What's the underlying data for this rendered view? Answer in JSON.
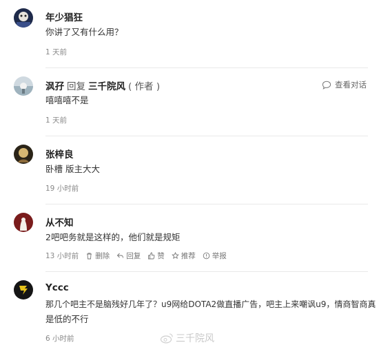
{
  "comments": [
    {
      "username": "年少猖狂",
      "text": "你讲了又有什么用？",
      "time": "1 天前"
    },
    {
      "username": "沨孖",
      "reply_word": "回复",
      "reply_target": "三千院风",
      "author_tag": "( 作者 )",
      "view_conversation": "查看对话",
      "text": "嘻嘻嘻不是",
      "time": "1 天前"
    },
    {
      "username": "张梓良",
      "text": "卧槽 版主大大",
      "time": "19 小时前"
    },
    {
      "username": "从不知",
      "text": "2吧吧务就是这样的，他们就是规矩",
      "time": "13 小时前",
      "actions": {
        "delete": "删除",
        "reply": "回复",
        "like": "赞",
        "recommend": "推荐",
        "report": "举报"
      }
    },
    {
      "username": "Yccc",
      "text_line1": "那几个吧主不是脑残好几年了？u9网给DOTA2做直播广告，吧主上来嘲讽u9，情商智商真",
      "text_line2": "是低的不行",
      "time": "6 小时前"
    }
  ],
  "watermark": "三千院风"
}
